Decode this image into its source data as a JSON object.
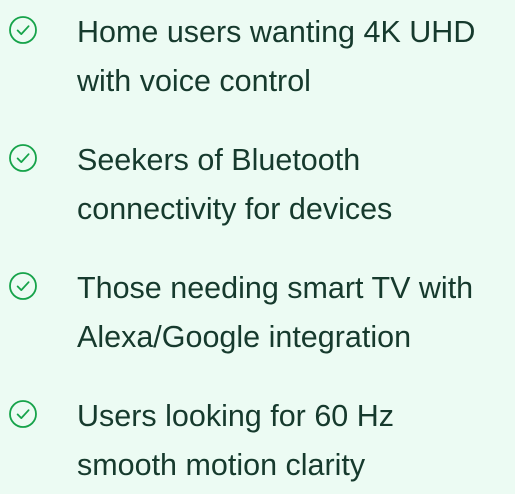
{
  "features": {
    "items": [
      {
        "icon": "check-circle-icon",
        "line1": "Home users wanting 4K UHD",
        "line2": "with voice control"
      },
      {
        "icon": "check-circle-icon",
        "line1": "Seekers of Bluetooth",
        "line2": "connectivity for devices"
      },
      {
        "icon": "check-circle-icon",
        "line1": "Those needing smart TV with",
        "line2": "Alexa/Google integration"
      },
      {
        "icon": "check-circle-icon",
        "line1": "Users looking for 60 Hz",
        "line2": "smooth motion clarity"
      }
    ]
  },
  "colors": {
    "background": "#ecfbf3",
    "text": "#163a2d",
    "accent": "#16a34a"
  }
}
